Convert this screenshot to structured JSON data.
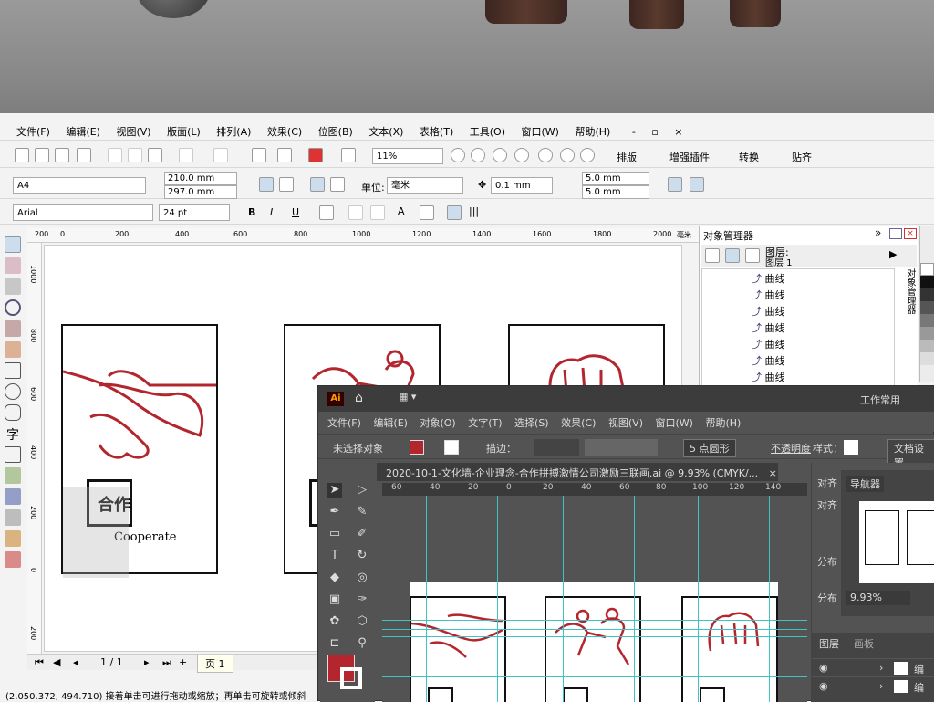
{
  "corel": {
    "menu": [
      "文件(F)",
      "编辑(E)",
      "视图(V)",
      "版面(L)",
      "排列(A)",
      "效果(C)",
      "位图(B)",
      "文本(X)",
      "表格(T)",
      "工具(O)",
      "窗口(W)",
      "帮助(H)"
    ],
    "window_controls": [
      "-",
      "▫",
      "×"
    ],
    "zoom": "11%",
    "toolbar_buttons": [
      "排版",
      "增强插件",
      "转换",
      "贴齐"
    ],
    "page_size": "A4",
    "width": "210.0 mm",
    "height": "297.0 mm",
    "unit_label": "单位:",
    "unit_value": "毫米",
    "nudge": "0.1 mm",
    "dup_x": "5.0 mm",
    "dup_y": "5.0 mm",
    "font_name": "Arial",
    "font_size": "24 pt",
    "ruler_h": [
      "200",
      "0",
      "200",
      "400",
      "600",
      "800",
      "1000",
      "1200",
      "1400",
      "1600",
      "1800",
      "2000"
    ],
    "ruler_h_unit": "毫米",
    "ruler_v": [
      "1000",
      "800",
      "600",
      "400",
      "200",
      "0",
      "200"
    ],
    "card1_title": "合作",
    "card1_subtitle": "Cooperate",
    "page_nav": "1 / 1",
    "page_tab": "页 1",
    "status": "(2,050.372, 494.710) 接着单击可进行拖动或缩放；再单击可旋转或倾斜",
    "object_manager": {
      "title": "对象管理器",
      "layer_header": "图层:",
      "layer_name": "图层 1",
      "items": [
        "曲线",
        "曲线",
        "曲线",
        "曲线",
        "曲线",
        "曲线",
        "曲线"
      ],
      "side_tab": "对象管理器"
    }
  },
  "ai": {
    "logo": "Ai",
    "workspace": "工作常用",
    "menu": [
      "文件(F)",
      "编辑(E)",
      "对象(O)",
      "文字(T)",
      "选择(S)",
      "效果(C)",
      "视图(V)",
      "窗口(W)",
      "帮助(H)"
    ],
    "no_selection": "未选择对象",
    "stroke_label": "描边：",
    "brush": "5 点圆形",
    "opacity": "不透明度",
    "style": "样式：",
    "doc_settings": "文档设置",
    "doc_tab": "2020-10-1-文化墙-企业理念-合作拼搏激情公司激励三联画.ai @ 9.93% (CMYK/...",
    "close": "×",
    "ruler": [
      "60",
      "40",
      "20",
      "0",
      "20",
      "40",
      "60",
      "80",
      "100",
      "120",
      "140"
    ],
    "navigator_tab": "导航器",
    "navigator_zoom": "9.93%",
    "align_labels": [
      "对齐",
      "分布",
      "分布"
    ],
    "layers_tab": "图层",
    "artboards_tab": "画板",
    "layer_items": [
      "编",
      "编"
    ]
  },
  "colors": {
    "brand_red": "#b3262d",
    "guide": "#3fc4c4",
    "ai_bg": "#535353"
  }
}
